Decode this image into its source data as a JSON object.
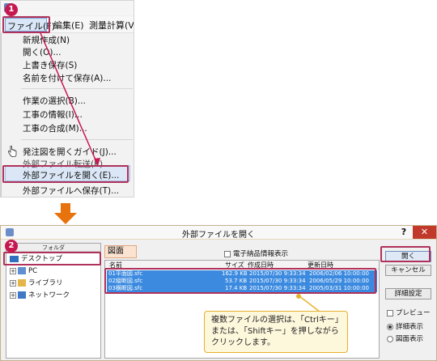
{
  "menu": {
    "bar": {
      "file": "ファイル(F)",
      "edit": "編集(E)",
      "survey": "測量計算(V)"
    },
    "items": [
      "新規作成(N)",
      "開く(O)...",
      "上書き保存(S)",
      "名前を付けて保存(A)...",
      "作業の選択(B)...",
      "工事の情報(I)...",
      "工事の合成(M)...",
      "発注図を開くガイド(J)...",
      "外部ファイル転送(K)",
      "外部ファイルを開く(E)...",
      "外部ファイルへ保存(T)..."
    ]
  },
  "steps": {
    "one": "1",
    "two": "2"
  },
  "dialog": {
    "title": "外部ファイルを開く",
    "help": "?",
    "close": "✕",
    "folder_header": "フォルダ",
    "tree": [
      "デスクトップ",
      "PC",
      "ライブラリ",
      "ネットワーク"
    ],
    "tab": "図面",
    "denshi_checkbox": "電子納品情報表示",
    "columns": {
      "name": "名前",
      "size": "サイズ",
      "created": "作成日時",
      "modified": "更新日時"
    },
    "files": [
      {
        "name": "01平面図.sfc",
        "size": "162.9 KB",
        "created": "2015/07/30 9:33:34",
        "modified": "2006/02/06 10:00:00"
      },
      {
        "name": "02縦断図.sfc",
        "size": "53.7 KB",
        "created": "2015/07/30 9:33:34",
        "modified": "2006/05/29 10:00:00"
      },
      {
        "name": "03横断図.sfc",
        "size": "17.4 KB",
        "created": "2015/07/30 9:33:34",
        "modified": "2005/03/31 10:00:00"
      }
    ],
    "buttons": {
      "open": "開く",
      "cancel": "キャンセル",
      "details": "詳細設定"
    },
    "preview": "プレビュー",
    "view_detail": "詳細表示",
    "view_figure": "図面表示"
  },
  "callout": {
    "line1": "複数ファイルの選択は、「Ctrlキー」",
    "line2": "または、「Shiftキー」を押しながら",
    "line3": "クリックします。"
  },
  "colors": {
    "accent_red": "#b0325a",
    "badge": "#c6184f",
    "arrow_orange": "#e8720c",
    "selection": "#3b8ae0",
    "callout_border": "#e7b12e"
  }
}
